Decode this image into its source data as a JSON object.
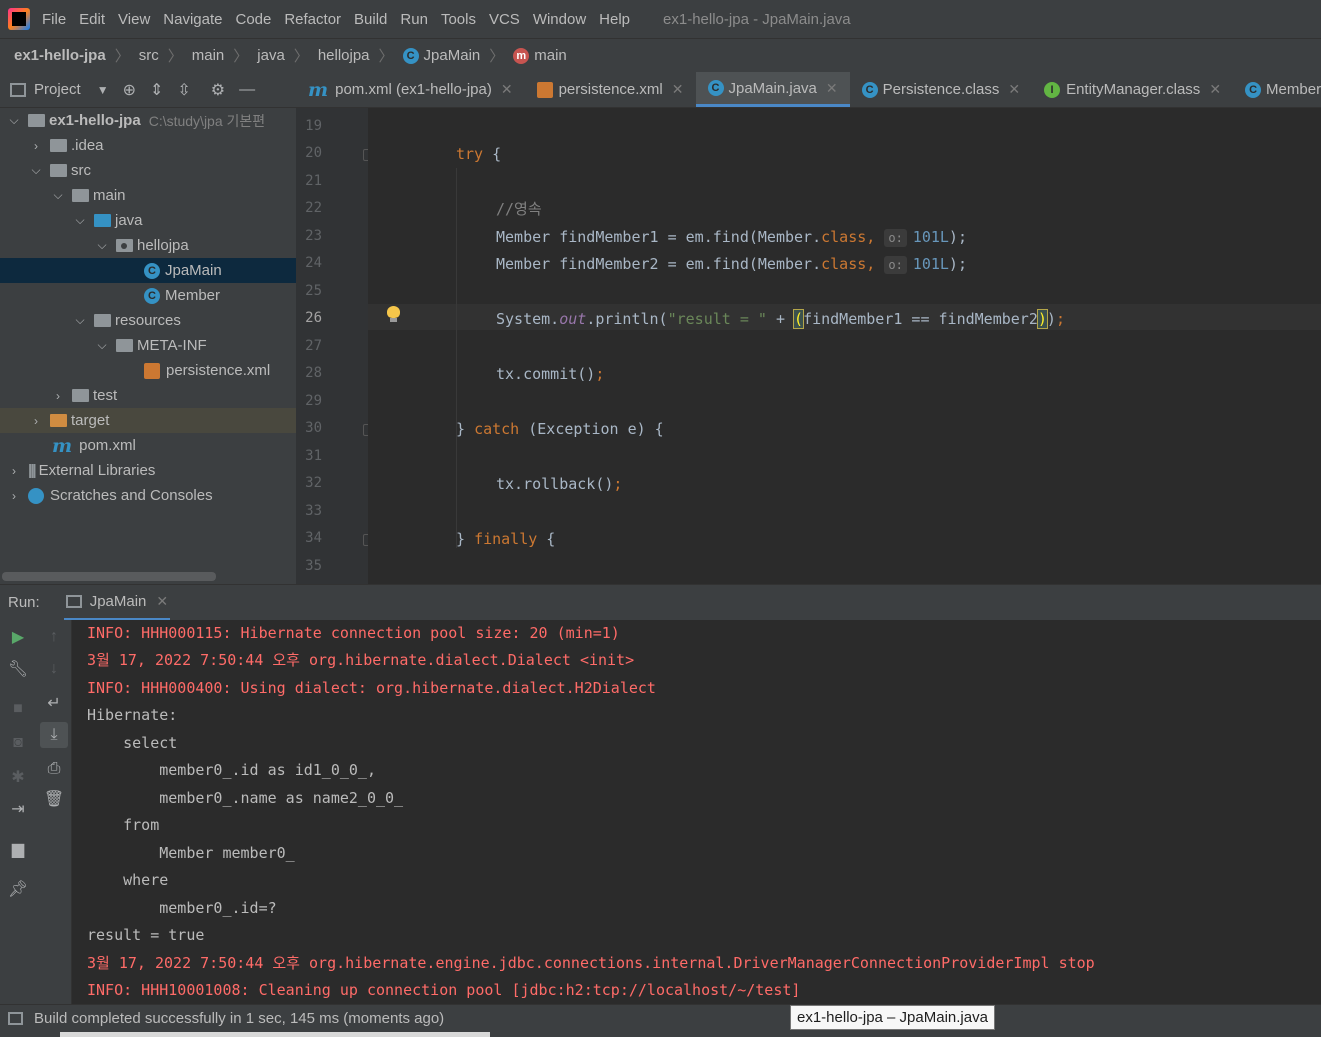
{
  "menu": {
    "items": [
      "File",
      "Edit",
      "View",
      "Navigate",
      "Code",
      "Refactor",
      "Build",
      "Run",
      "Tools",
      "VCS",
      "Window",
      "Help"
    ],
    "window_title": "ex1-hello-jpa - JpaMain.java"
  },
  "breadcrumbs": [
    "ex1-hello-jpa",
    "src",
    "main",
    "java",
    "hellojpa",
    "JpaMain",
    "main"
  ],
  "project_panel": {
    "title": "Project",
    "tree": [
      {
        "label": "ex1-hello-jpa",
        "hint": "C:\\study\\jpa 기본편"
      },
      {
        "label": ".idea"
      },
      {
        "label": "src"
      },
      {
        "label": "main"
      },
      {
        "label": "java"
      },
      {
        "label": "hellojpa"
      },
      {
        "label": "JpaMain"
      },
      {
        "label": "Member"
      },
      {
        "label": "resources"
      },
      {
        "label": "META-INF"
      },
      {
        "label": "persistence.xml"
      },
      {
        "label": "test"
      },
      {
        "label": "target"
      },
      {
        "label": "pom.xml"
      },
      {
        "label": "External Libraries"
      },
      {
        "label": "Scratches and Consoles"
      }
    ]
  },
  "editor_tabs": [
    {
      "label": "pom.xml (ex1-hello-jpa)",
      "icon": "maven-icon"
    },
    {
      "label": "persistence.xml",
      "icon": "xml-icon"
    },
    {
      "label": "JpaMain.java",
      "icon": "class-icon",
      "active": true
    },
    {
      "label": "Persistence.class",
      "icon": "class-icon"
    },
    {
      "label": "EntityManager.class",
      "icon": "interface-icon"
    },
    {
      "label": "Member.jav",
      "icon": "class-icon"
    }
  ],
  "editor": {
    "line_numbers": [
      "19",
      "20",
      "21",
      "22",
      "23",
      "24",
      "25",
      "26",
      "27",
      "28",
      "29",
      "30",
      "31",
      "32",
      "33",
      "34",
      "35"
    ],
    "current_line": "26",
    "code": {
      "try_kw": "try",
      "brace_open": " {",
      "comment": "//영속",
      "member_type": "Member",
      "find1_left": " findMember1 = em.find(Member.",
      "find2_left": " findMember2 = em.find(Member.",
      "class_kw": "class",
      "comma": ", ",
      "hint_label": "o:",
      "id_value": "101L",
      "close_paren_semi": ");",
      "system": "System.",
      "out": "out",
      "println": ".println(",
      "result_string": "\"result = \"",
      "plus": " + ",
      "paren_open": "(",
      "compare": "findMember1 == findMember2",
      "paren_close": ")",
      "close_call": ")",
      "semi": ";",
      "commit": "tx.commit()",
      "catch_close": "} ",
      "catch_kw": "catch",
      "catch_rest": " (Exception e) {",
      "rollback": "tx.rollback()",
      "finally_kw": "finally"
    }
  },
  "run_panel": {
    "label": "Run:",
    "tab": "JpaMain",
    "console": [
      {
        "text": "INFO: HHH000115: Hibernate connection pool size: 20 (min=1)",
        "type": "err"
      },
      {
        "text": "3월 17, 2022 7:50:44 오후 org.hibernate.dialect.Dialect <init>",
        "type": "err"
      },
      {
        "text": "INFO: HHH000400: Using dialect: org.hibernate.dialect.H2Dialect",
        "type": "err"
      },
      {
        "text": "Hibernate:",
        "type": "out"
      },
      {
        "text": "    select",
        "type": "out"
      },
      {
        "text": "        member0_.id as id1_0_0_,",
        "type": "out"
      },
      {
        "text": "        member0_.name as name2_0_0_",
        "type": "out"
      },
      {
        "text": "    from",
        "type": "out"
      },
      {
        "text": "        Member member0_",
        "type": "out"
      },
      {
        "text": "    where",
        "type": "out"
      },
      {
        "text": "        member0_.id=?",
        "type": "out"
      },
      {
        "text": "result = true",
        "type": "out"
      },
      {
        "text": "3월 17, 2022 7:50:44 오후 org.hibernate.engine.jdbc.connections.internal.DriverManagerConnectionProviderImpl stop",
        "type": "err"
      },
      {
        "text": "INFO: HHH10001008: Cleaning up connection pool [jdbc:h2:tcp://localhost/~/test]",
        "type": "err"
      }
    ]
  },
  "status_bar": {
    "text": "Build completed successfully in 1 sec, 145 ms (moments ago)",
    "tooltip": "ex1-hello-jpa – JpaMain.java"
  },
  "colors": {
    "keyword": "#cc7832",
    "string": "#6a8759",
    "number": "#6897bb",
    "comment": "#808080",
    "console_error": "#ff6b68",
    "selection": "#0d293e",
    "accent": "#4a88c7"
  }
}
